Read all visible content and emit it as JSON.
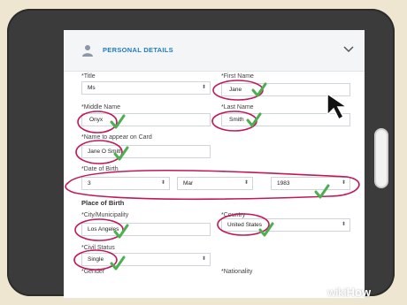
{
  "section": {
    "title": "PERSONAL DETAILS",
    "icon": "person-icon"
  },
  "fields": {
    "title": {
      "label": "*Title",
      "value": "Ms"
    },
    "first_name": {
      "label": "*First Name",
      "value": "Jane"
    },
    "middle_name": {
      "label": "*Middle Name",
      "value": "Onyx"
    },
    "last_name": {
      "label": "*Last Name",
      "value": "Smith"
    },
    "card_name": {
      "label": "*Name to appear on Card",
      "value": "Jane O Smith"
    },
    "dob": {
      "label": "*Date of Birth",
      "day": "3",
      "month": "Mar",
      "year": "1983"
    },
    "place_of_birth": {
      "label": "Place of Birth"
    },
    "city": {
      "label": "*City/Municipality",
      "value": "Los Angeles"
    },
    "country": {
      "label": "*Country",
      "value": "United States"
    },
    "civil_status": {
      "label": "*Civil Status",
      "value": "Single"
    },
    "gender": {
      "label": "*Gender"
    },
    "nationality": {
      "label": "*Nationality"
    }
  },
  "watermark": {
    "wiki": "wiki",
    "how": "How"
  },
  "colors": {
    "accent": "#1f7bc4",
    "annotation": "#c2185b",
    "check": "#4caf50"
  }
}
